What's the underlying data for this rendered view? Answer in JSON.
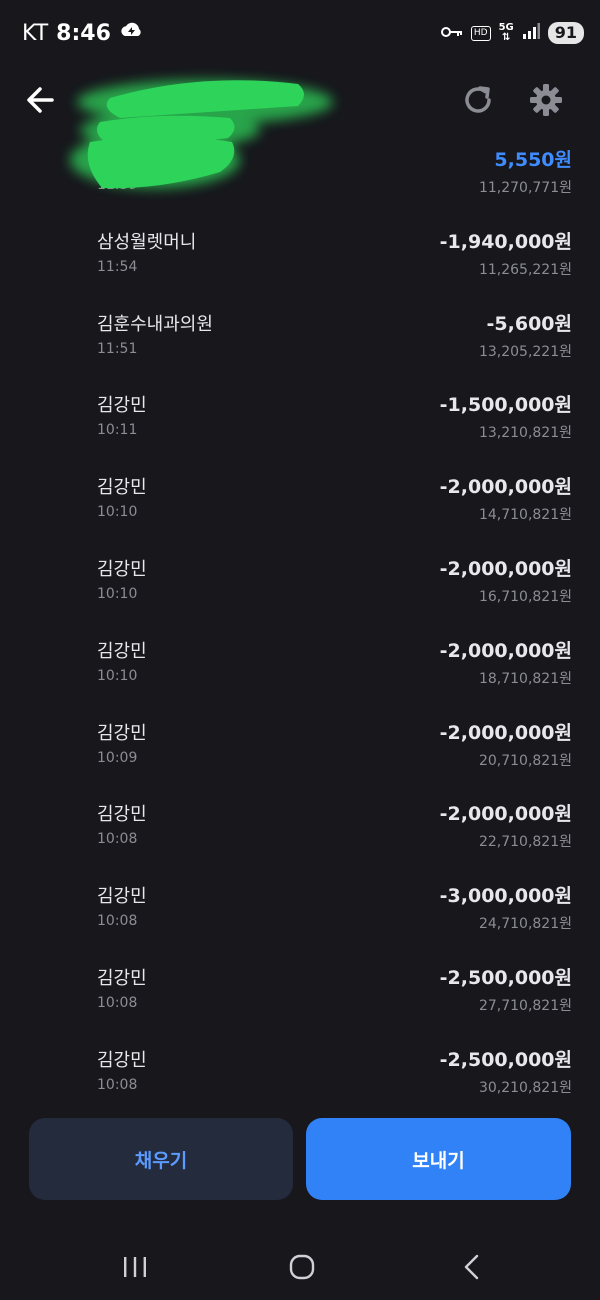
{
  "status_bar": {
    "carrier": "KT",
    "time": "8:46",
    "hd_badge": "HD",
    "network": "5G",
    "battery": "91"
  },
  "header": {
    "back_icon": "arrow-left-icon",
    "refresh_icon": "refresh-icon",
    "settings_icon": "gear-icon"
  },
  "transactions": [
    {
      "name": "",
      "time": "11:59",
      "amount": "5,550원",
      "balance": "11,270,771원",
      "positive": true
    },
    {
      "name": "삼성월렛머니",
      "time": "11:54",
      "amount": "-1,940,000원",
      "balance": "11,265,221원"
    },
    {
      "name": "김훈수내과의원",
      "time": "11:51",
      "amount": "-5,600원",
      "balance": "13,205,221원"
    },
    {
      "name": "김강민",
      "time": "10:11",
      "amount": "-1,500,000원",
      "balance": "13,210,821원"
    },
    {
      "name": "김강민",
      "time": "10:10",
      "amount": "-2,000,000원",
      "balance": "14,710,821원"
    },
    {
      "name": "김강민",
      "time": "10:10",
      "amount": "-2,000,000원",
      "balance": "16,710,821원"
    },
    {
      "name": "김강민",
      "time": "10:10",
      "amount": "-2,000,000원",
      "balance": "18,710,821원"
    },
    {
      "name": "김강민",
      "time": "10:09",
      "amount": "-2,000,000원",
      "balance": "20,710,821원"
    },
    {
      "name": "김강민",
      "time": "10:08",
      "amount": "-2,000,000원",
      "balance": "22,710,821원"
    },
    {
      "name": "김강민",
      "time": "10:08",
      "amount": "-3,000,000원",
      "balance": "24,710,821원"
    },
    {
      "name": "김강민",
      "time": "10:08",
      "amount": "-2,500,000원",
      "balance": "27,710,821원"
    },
    {
      "name": "김강민",
      "time": "10:08",
      "amount": "-2,500,000원",
      "balance": "30,210,821원"
    }
  ],
  "actions": {
    "fill_label": "채우기",
    "send_label": "보내기"
  },
  "colors": {
    "background": "#17171c",
    "positive_amount": "#3f8cff",
    "send_button": "#3182f6",
    "fill_button": "#232b3d",
    "redaction": "#2ed35a"
  }
}
